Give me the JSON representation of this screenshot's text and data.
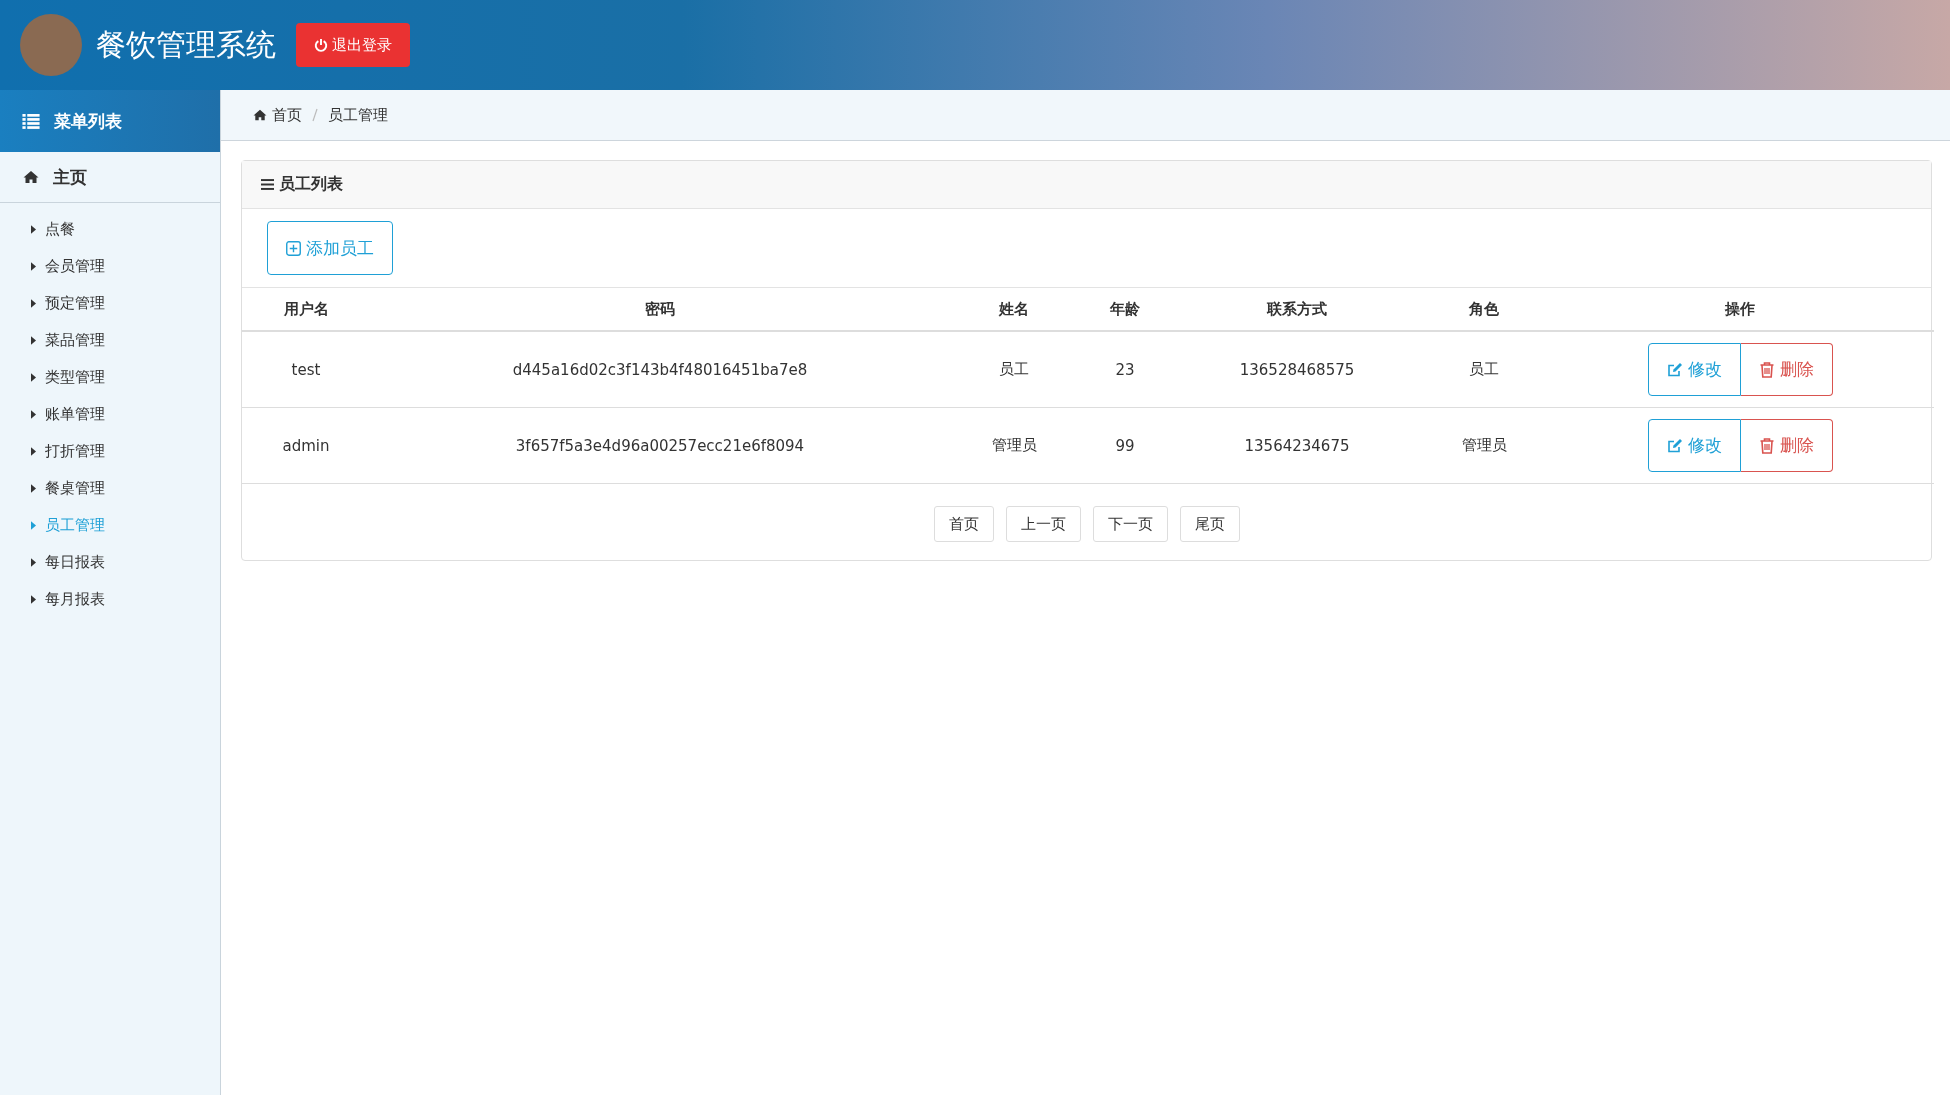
{
  "header": {
    "title": "餐饮管理系统",
    "logout_button": "退出登录"
  },
  "sidebar": {
    "title": "菜单列表",
    "home": "主页",
    "items": [
      {
        "label": "点餐",
        "selected": false
      },
      {
        "label": "会员管理",
        "selected": false
      },
      {
        "label": "预定管理",
        "selected": false
      },
      {
        "label": "菜品管理",
        "selected": false
      },
      {
        "label": "类型管理",
        "selected": false
      },
      {
        "label": "账单管理",
        "selected": false
      },
      {
        "label": "打折管理",
        "selected": false
      },
      {
        "label": "餐桌管理",
        "selected": false
      },
      {
        "label": "员工管理",
        "selected": true
      },
      {
        "label": "每日报表",
        "selected": false
      },
      {
        "label": "每月报表",
        "selected": false
      }
    ]
  },
  "breadcrumb": [
    "首页",
    "员工管理"
  ],
  "panel": {
    "title": "员工列表",
    "add_button": "添加员工",
    "table": {
      "columns": [
        "用户名",
        "密码",
        "姓名",
        "年龄",
        "联系方式",
        "角色",
        "操作"
      ],
      "rows": [
        {
          "cells": [
            "test",
            "d445a16d02c3f143b4f48016451ba7e8",
            "员工",
            "23",
            "136528468575",
            "员工"
          ],
          "edit": "修改",
          "delete": "删除"
        },
        {
          "cells": [
            "admin",
            "3f657f5a3e4d96a00257ecc21e6f8094",
            "管理员",
            "99",
            "13564234675",
            "管理员"
          ],
          "edit": "修改",
          "delete": "删除"
        }
      ]
    },
    "pagination": [
      "首页",
      "上一页",
      "下一页",
      "尾页"
    ]
  }
}
